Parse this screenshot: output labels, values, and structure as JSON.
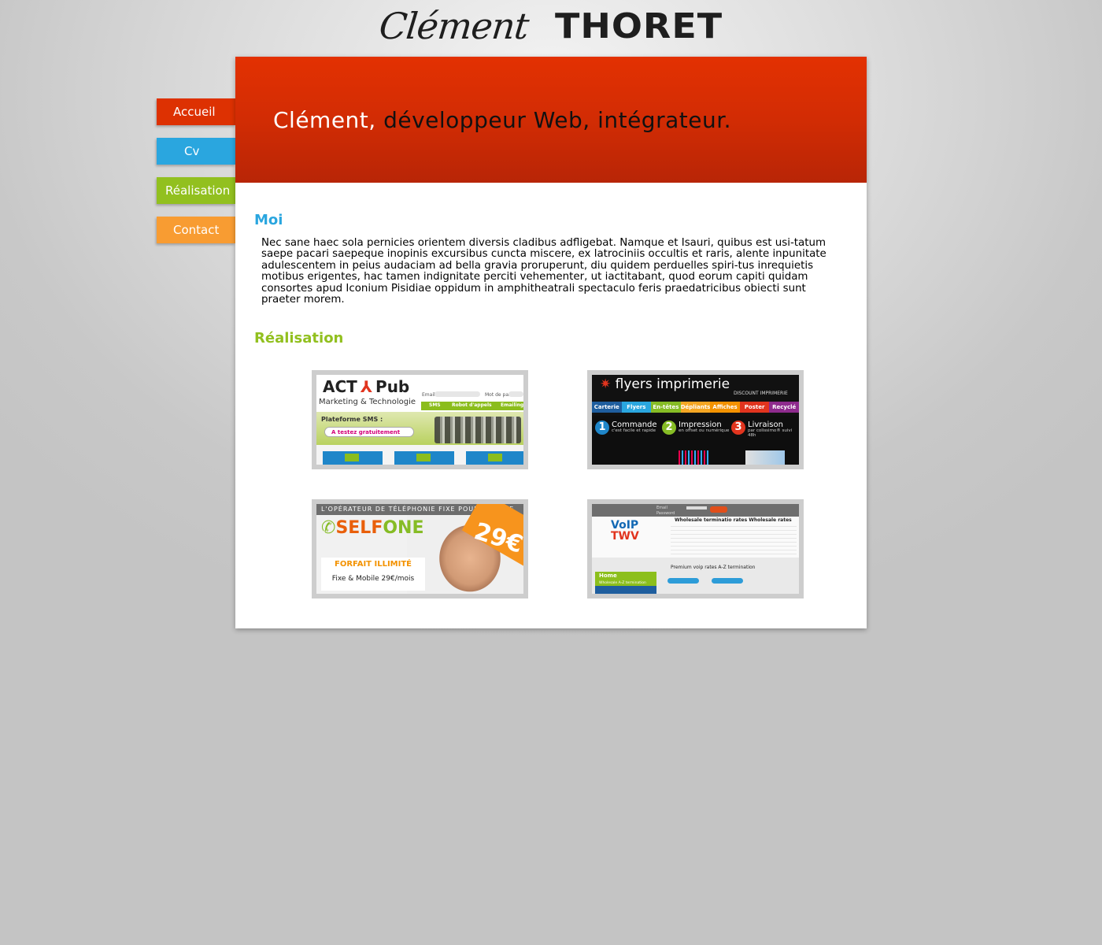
{
  "header": {
    "logo_first": "Clément",
    "logo_last": "THORET"
  },
  "nav": {
    "items": [
      {
        "label": "Accueil",
        "color": "#dd3102"
      },
      {
        "label": "Cv",
        "color": "#2aa6df"
      },
      {
        "label": "Réalisation",
        "color": "#92c01f"
      },
      {
        "label": "Contact",
        "color": "#f89c32"
      }
    ]
  },
  "banner": {
    "name": "Clément,",
    "tagline": " développeur Web, intégrateur.",
    "color": "#dd3102"
  },
  "moi": {
    "title": "Moi",
    "title_color": "#2aa6df",
    "text": "Nec sane haec sola pernicies orientem diversis cladibus adfligebat. Namque et Isauri, quibus est usi-tatum saepe pacari saepeque inopinis excursibus cuncta miscere, ex latrociniis occultis et raris, alente inpunitate adulescentem in peius audaciam ad bella gravia proruperunt, diu quidem perduelles spiri-tus inrequietis motibus erigentes, hac tamen indignitate perciti vehementer, ut iactitabant, quod eorum capiti quidam consortes apud Iconium Pisidiae oppidum in amphitheatrali spectaculo feris praedatricibus obiecti sunt praeter morem."
  },
  "realisation": {
    "title": "Réalisation",
    "title_color": "#92c01f",
    "projects": [
      {
        "name": "ACT Pub",
        "logo_left": "ACT",
        "logo_right": "Pub",
        "subtitle": "Marketing & Technologie",
        "email_label": "Email",
        "password_label": "Mot de passe",
        "menu": [
          "SMS",
          "Robot d'appels",
          "Emailing"
        ],
        "headline": "Plateforme SMS :",
        "cta": "A testez gratuitement"
      },
      {
        "name": "flyers imprimerie",
        "tagline": "DISCOUNT IMPRIMERIE",
        "categories": [
          {
            "label": "Carterie",
            "color": "#1f5e9e"
          },
          {
            "label": "Flyers",
            "color": "#2aa6df"
          },
          {
            "label": "En-têtes",
            "color": "#86bc25"
          },
          {
            "label": "Dépliants",
            "color": "#f5a623"
          },
          {
            "label": "Affiches",
            "color": "#f39200"
          },
          {
            "label": "Poster",
            "color": "#e1341e"
          },
          {
            "label": "Recyclé",
            "color": "#8e2b8d"
          }
        ],
        "steps": [
          {
            "num": "1",
            "label": "Commande",
            "sub": "c'est facile et rapide",
            "color": "#1f86c9"
          },
          {
            "num": "2",
            "label": "Impression",
            "sub": "en offset ou numérique",
            "color": "#86bc25"
          },
          {
            "num": "3",
            "label": "Livraison",
            "sub": "par colissimo® suivi 48h",
            "color": "#e1341e"
          }
        ]
      },
      {
        "name": "SELFONE",
        "banner_text": "L'OPÉRATEUR DE TÉLÉPHONIE FIXE POUR LES PME",
        "logo_prefix": "SELF",
        "logo_suffix": "ONE",
        "price": "29€",
        "offer_title": "FORFAIT ILLIMITÉ",
        "offer_detail": "Fixe & Mobile 29€/mois"
      },
      {
        "name": "VoIP TWV",
        "email_label": "Email",
        "password_label": "Password",
        "logo_top": "VoIP",
        "logo_bottom": "TWV",
        "table_title": "Wholesale terminatio rates  Wholesale rates",
        "home_label": "Home",
        "home_sub": "Wholesale A-Z termination",
        "premium": "Premium voip rates A-Z termination"
      }
    ]
  }
}
